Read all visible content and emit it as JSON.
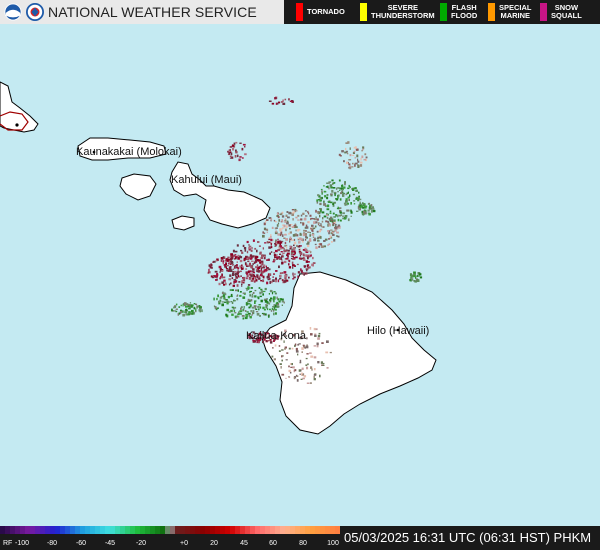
{
  "header": {
    "title": "NATIONAL WEATHER SERVICE",
    "warnings": [
      {
        "label_1": "TORNADO",
        "label_2": "",
        "color": "#ff0000"
      },
      {
        "label_1": "SEVERE",
        "label_2": "THUNDERSTORM",
        "color": "#ffff00"
      },
      {
        "label_1": "FLASH",
        "label_2": "FLOOD",
        "color": "#00aa00"
      },
      {
        "label_1": "SPECIAL",
        "label_2": "MARINE",
        "color": "#ff9900"
      },
      {
        "label_1": "SNOW",
        "label_2": "SQUALL",
        "color": "#c71585"
      }
    ]
  },
  "map": {
    "places": [
      {
        "name": "Kaunakakai (Molokai)"
      },
      {
        "name": "Kahului (Maui)"
      },
      {
        "name": "Kailua-Kona"
      },
      {
        "name": "Hilo (Hawaii)"
      }
    ]
  },
  "footer": {
    "scale_unit": "RF",
    "scale_ticks": [
      "-100",
      "-80",
      "-60",
      "-45",
      "-20",
      "+0",
      "20",
      "45",
      "60",
      "80",
      "100"
    ],
    "timestamp": "05/03/2025 16:31 UTC (06:31 HST) PHKM"
  },
  "colors": {
    "water": "#c4eaf2",
    "land": "#ffffff",
    "inbound": "#2e8b2e",
    "outbound": "#8b0020"
  }
}
